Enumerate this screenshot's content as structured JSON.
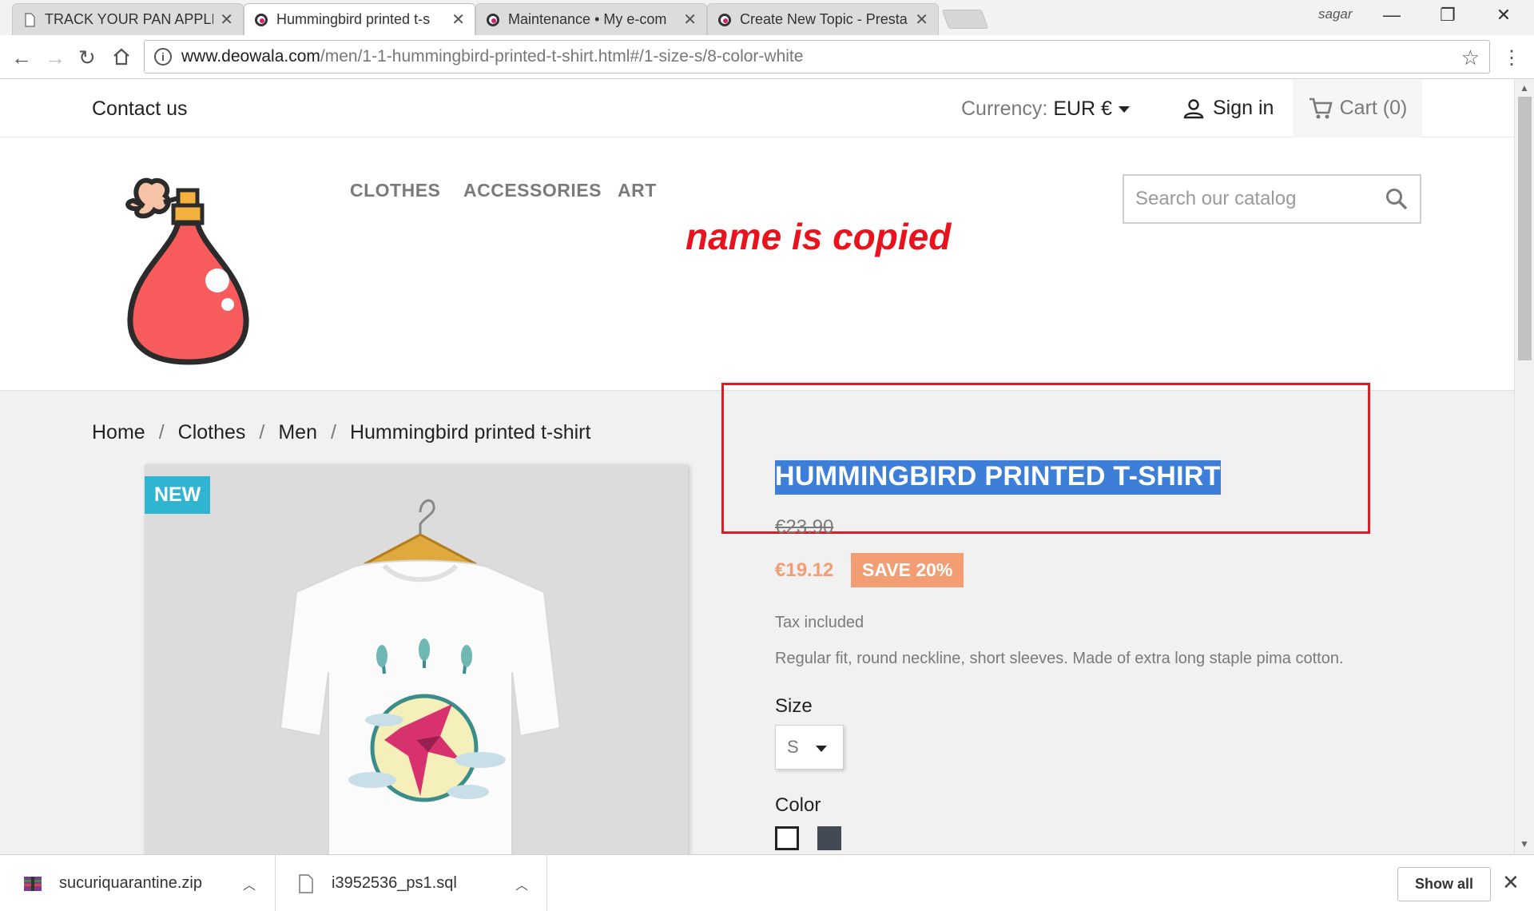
{
  "browser": {
    "tabs": [
      {
        "label": "TRACK YOUR PAN APPLIC",
        "icon": "document-icon"
      },
      {
        "label": "Hummingbird printed t-s",
        "icon": "prestashop-icon"
      },
      {
        "label": "Maintenance • My e-com",
        "icon": "prestashop-icon"
      },
      {
        "label": "Create New Topic - Presta",
        "icon": "prestashop-icon"
      }
    ],
    "tab_close": "✕",
    "user": "sagar",
    "url_host": "www.deowala.com",
    "url_path": "/men/1-1-hummingbird-printed-t-shirt.html#/1-size-s/8-color-white"
  },
  "site": {
    "contact": "Contact us",
    "currency_label": "Currency:",
    "currency_value": "EUR €",
    "signin": "Sign in",
    "cart": "Cart (0)",
    "menu": [
      "CLOTHES",
      "ACCESSORIES",
      "ART"
    ],
    "search_placeholder": "Search our catalog",
    "annotation": "name is copied",
    "breadcrumb": [
      "Home",
      "Clothes",
      "Men",
      "Hummingbird printed t-shirt"
    ],
    "badge": "NEW",
    "product": {
      "title": "HUMMINGBIRD PRINTED T-SHIRT",
      "old_price": "€23.90",
      "price": "€19.12",
      "discount": "SAVE 20%",
      "tax": "Tax included",
      "description": "Regular fit, round neckline, short sleeves. Made of extra long staple pima cotton.",
      "size_label": "Size",
      "size_value": "S",
      "color_label": "Color",
      "colors": [
        "#ffffff",
        "#434a54"
      ]
    }
  },
  "downloads": {
    "items": [
      "sucuriquarantine.zip",
      "i3952536_ps1.sql"
    ],
    "show_all": "Show all"
  }
}
